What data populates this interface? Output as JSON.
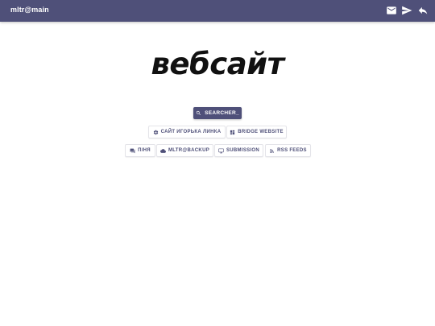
{
  "header": {
    "brand": "mltr@main",
    "icons": [
      "mail-icon",
      "send-icon",
      "reply-icon"
    ]
  },
  "main": {
    "logo_text": "вебсайт",
    "search_label": "SEARCHER_"
  },
  "links_row1": [
    {
      "label": "САЙТ ИГОРЬКА ЛИНКА",
      "icon": "gear-icon"
    },
    {
      "label": "BRIDGE WEBSITE",
      "icon": "dashboard-icon"
    }
  ],
  "links_row2": [
    {
      "label": "П/НЯ",
      "icon": "chat-icon"
    },
    {
      "label": "MLTR@BACKUP",
      "icon": "cloud-icon"
    },
    {
      "label": "SUBMISSION",
      "icon": "monitor-icon"
    },
    {
      "label": "RSS FEEDS",
      "icon": "rss-icon"
    }
  ],
  "colors": {
    "primary": "#4f5079",
    "background": "#ffffff",
    "chip_border": "#e4e4e9",
    "text_dark": "#111111"
  }
}
